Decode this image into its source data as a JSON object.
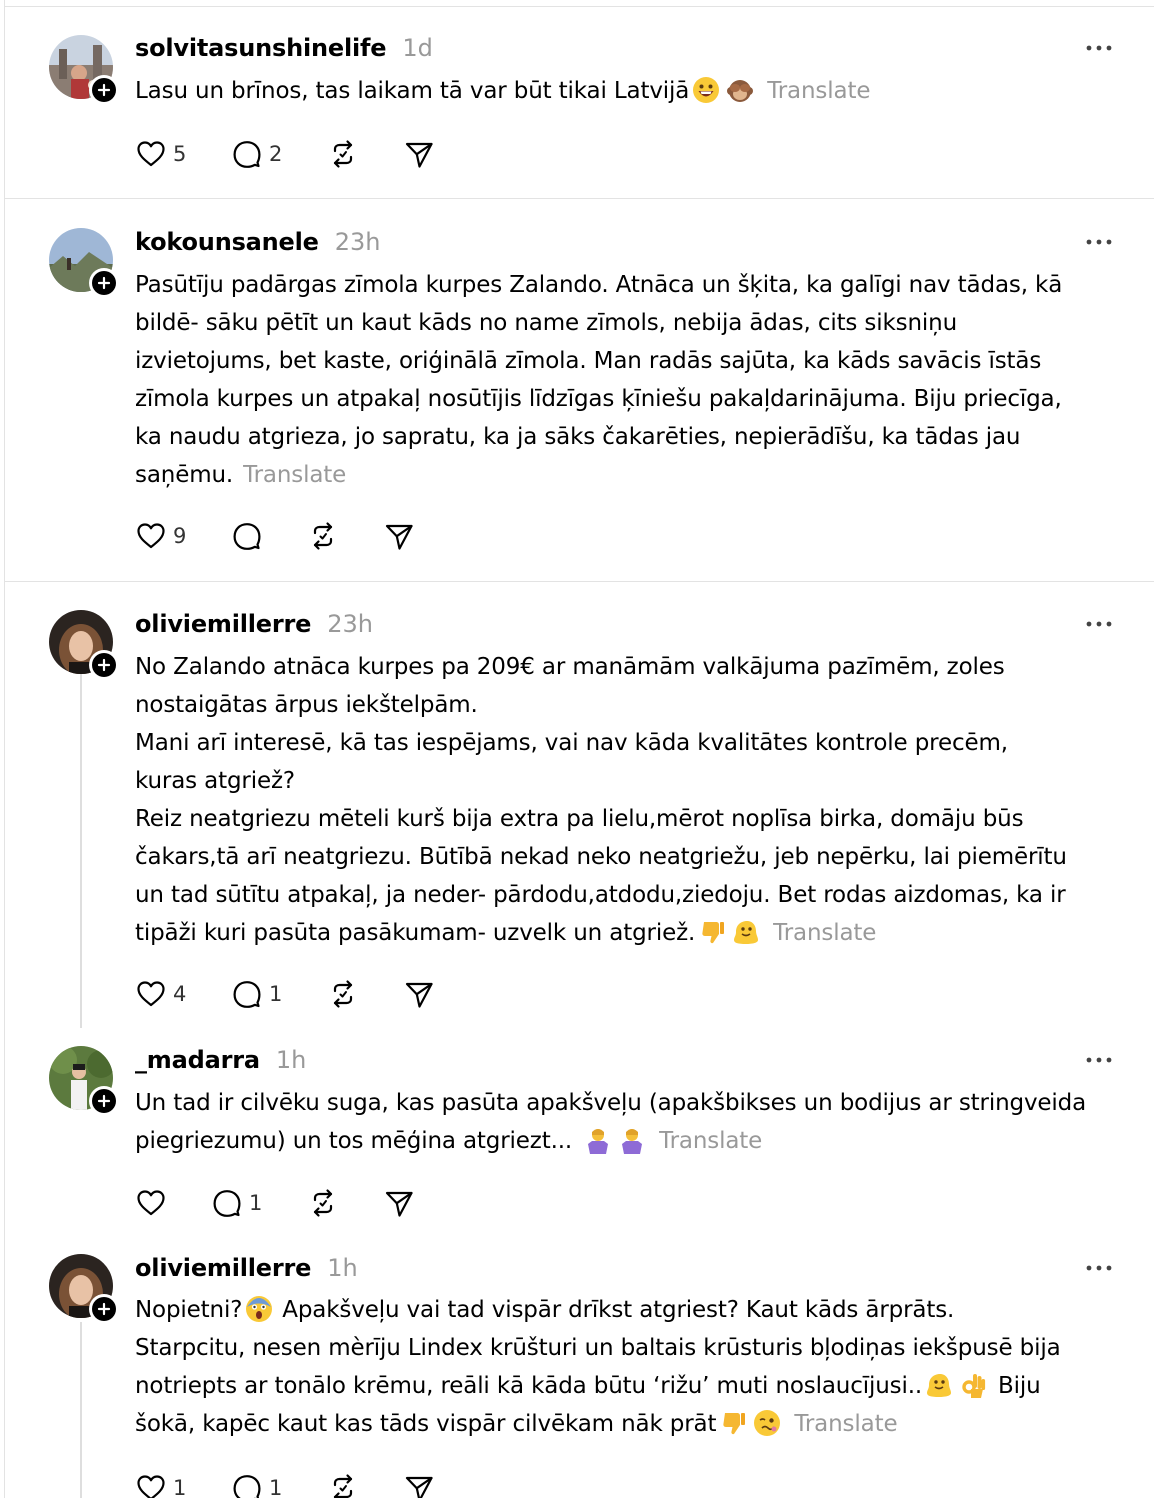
{
  "translate_label": "Translate",
  "posts": [
    {
      "username": "solvitasunshinelife",
      "time": "1d",
      "lines": [
        "Lasu un brīnos, tas laikam tā var būt tikai Latvijā"
      ],
      "likes": "5",
      "replies": "2"
    },
    {
      "username": "kokounsanele",
      "time": "23h",
      "lines": [
        "Pasūtīju padārgas zīmola kurpes Zalando. Atnāca un šķita, ka galīgi nav tādas, kā",
        "bildē- sāku pētīt un kaut kāds no name zīmols, nebija ādas, cits siksniņu",
        "izvietojums, bet kaste, oriģinālā zīmola. Man radās sajūta, ka kāds savācis īstās",
        "zīmola kurpes un atpakaļ nosūtījis līdzīgas ķīniešu pakaļdarinājuma. Biju priecīga,",
        "ka naudu atgrieza, jo sapratu, ka ja sāks čakarēties, nepierādīšu, ka tādas jau",
        "saņēmu."
      ],
      "likes": "9",
      "replies": ""
    },
    {
      "username": "oliviemillerre",
      "time": "23h",
      "lines": [
        "No Zalando atnāca kurpes pa 209€ ar manāmām valkājuma pazīmēm, zoles",
        "nostaigātas ārpus iekštelpām.",
        "Mani arī interesē, kā tas iespējams, vai nav kāda kvalitātes kontrole precēm,",
        "kuras atgriež?",
        "Reiz neatgriezu mēteli kurš bija extra pa lielu,mērot noplīsa birka, domāju būs",
        "čakars,tā arī neatgriezu. Būtībā nekad neko neatgriežu, jeb nepērku, lai piemērītu",
        "un tad sūtītu atpakaļ, ja neder- pārdodu,atdodu,ziedoju. Bet rodas aizdomas, ka ir",
        "tipāži kuri pasūta pasākumam- uzvelk un atgriež."
      ],
      "likes": "4",
      "replies": "1"
    },
    {
      "username": "_madarra",
      "time": "1h",
      "lines": [
        "Un tad ir cilvēku suga, kas pasūta apakšveļu (apakšbikses un bodijus ar stringveida",
        "piegriezumu) un tos mēģina atgriezt..."
      ],
      "likes": "",
      "replies": "1"
    },
    {
      "username": "oliviemillerre",
      "time": "1h",
      "lines": [
        "Nopietni?",
        "Apakšveļu vai tad vispār drīkst atgriest? Kaut kāds ārprāts.",
        "Starpcitu, nesen mèrīju Lindex krūšturi un baltais krūsturis bļodiņas iekšpusē bija",
        "notriepts ar tonālo krēmu, reāli kā kāda būtu ‘rižu’ muti noslaucījusi..",
        "Biju",
        "šokā, kapēc kaut kas tāds vispār cilvēkam nāk prāt"
      ],
      "likes": "1",
      "replies": "1"
    }
  ],
  "icons": {
    "like": "heart-icon",
    "reply": "comment-icon",
    "repost": "repost-icon",
    "share": "send-icon",
    "more": "more-icon",
    "follow": "plus-icon"
  },
  "colors": {
    "text": "#000000",
    "muted": "#999999",
    "divider": "#e3e3e3",
    "thread": "#dedede"
  }
}
